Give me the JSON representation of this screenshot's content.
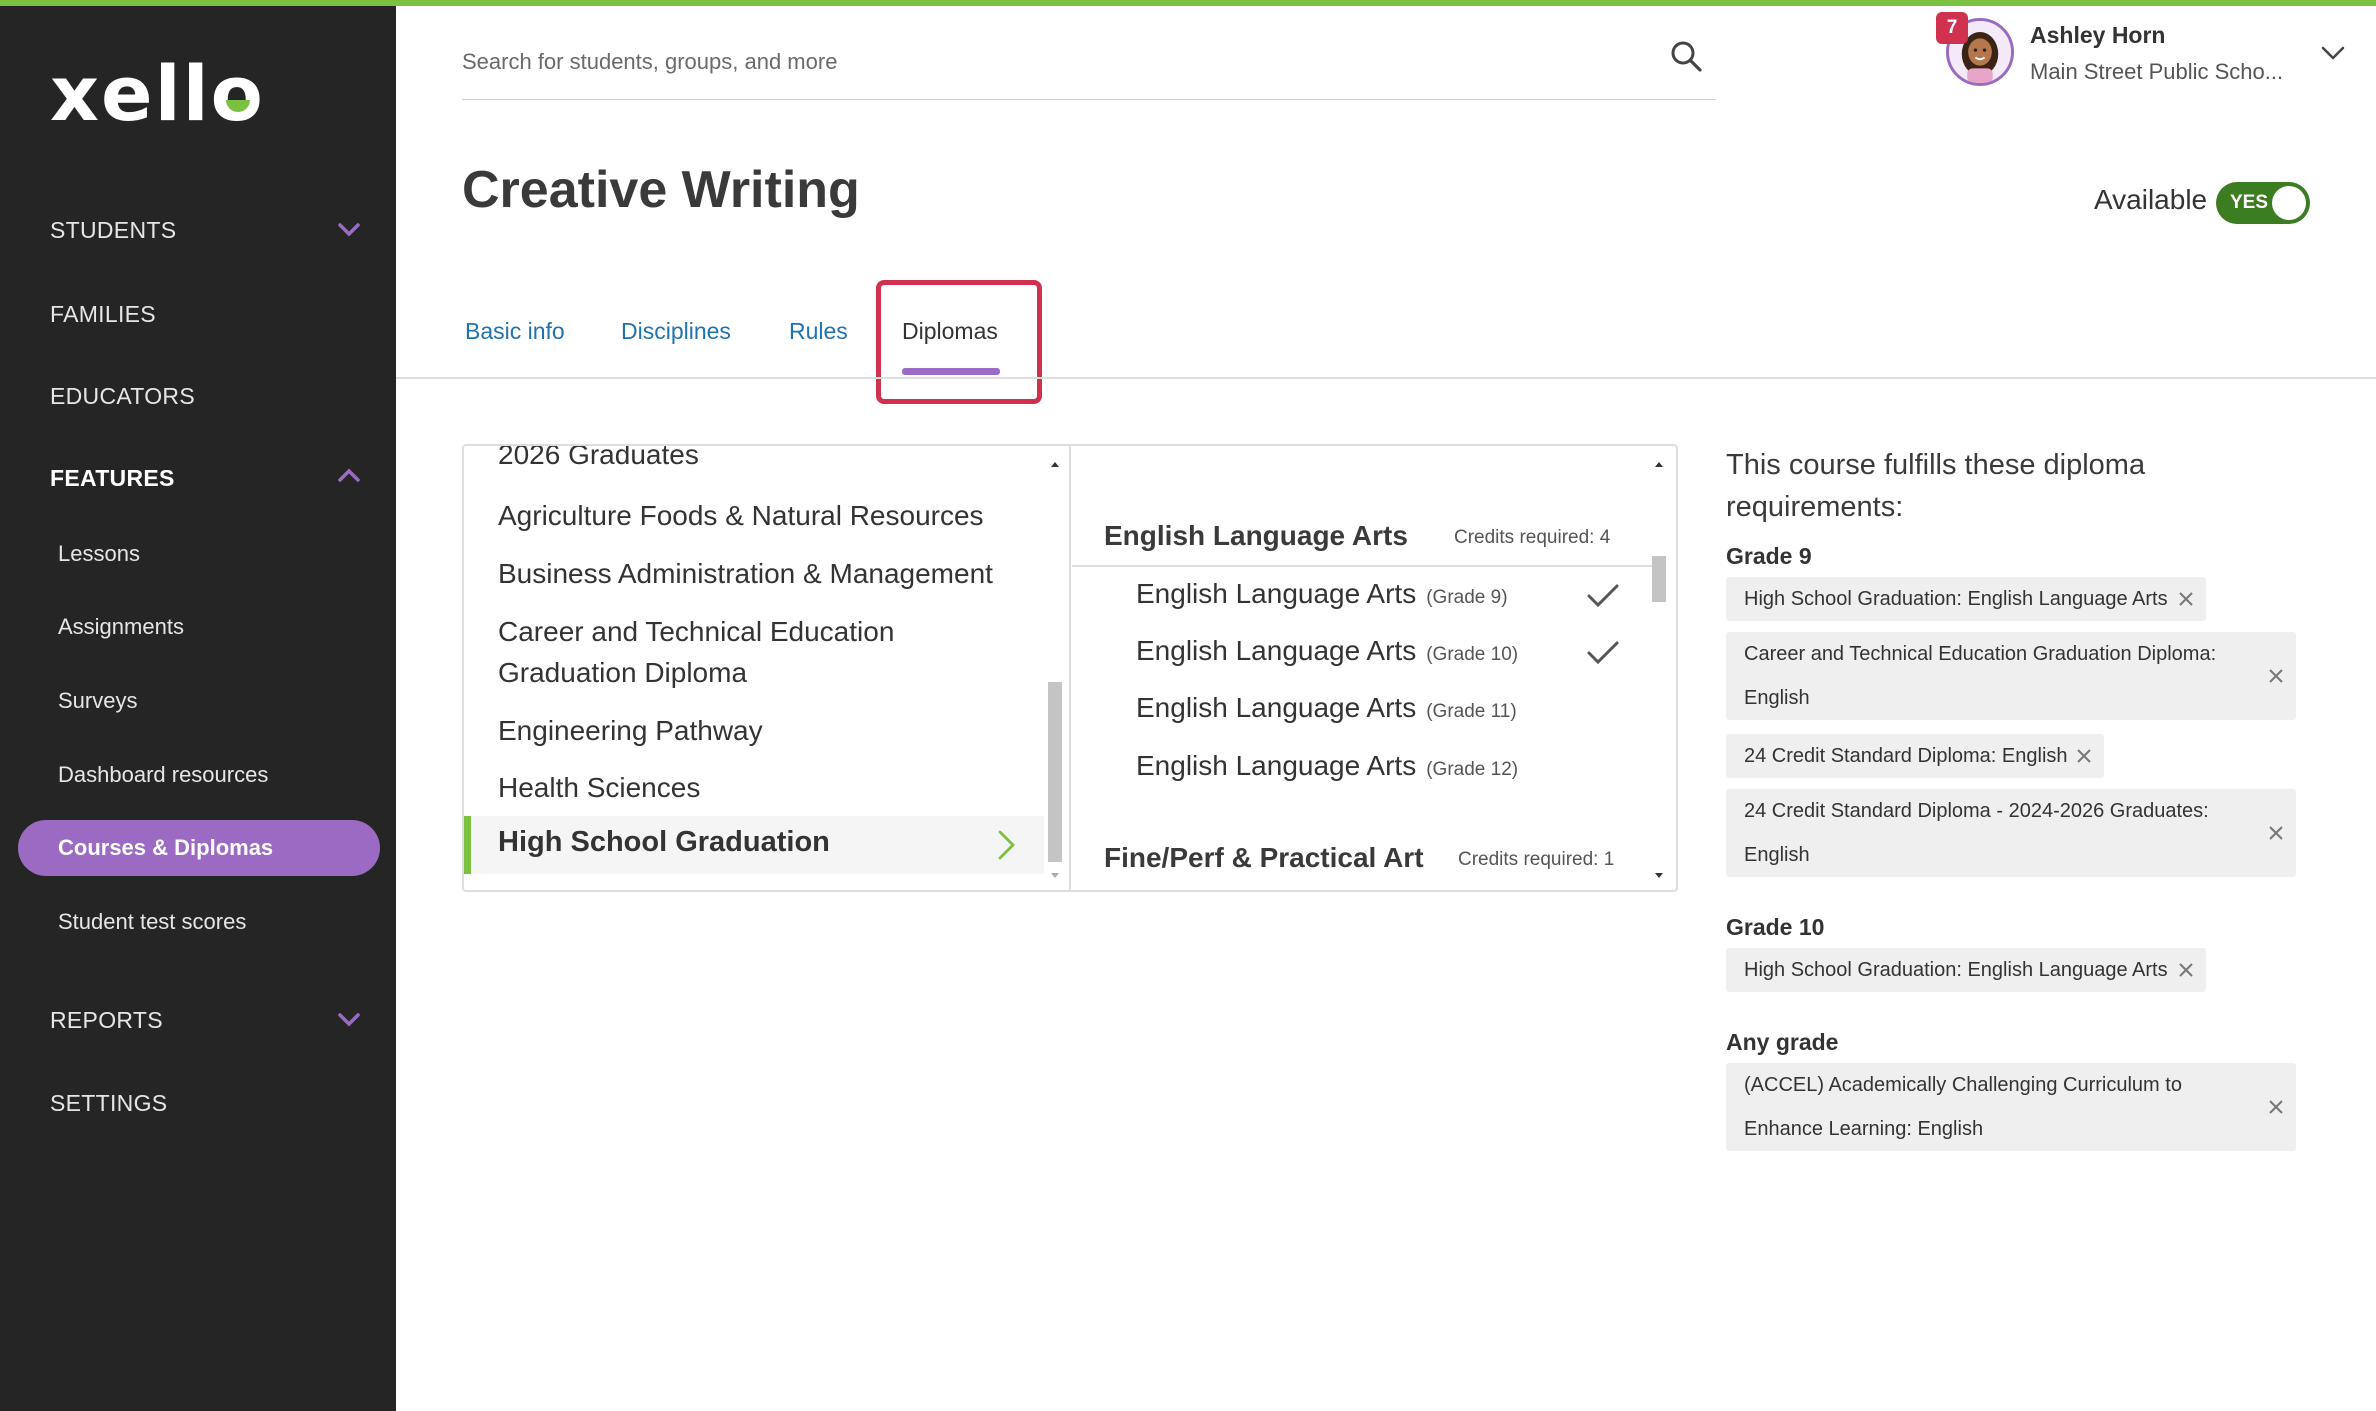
{
  "app": {
    "logo_text": "xello",
    "accent": "#9b6bc3",
    "brand_green": "#7ac142",
    "alert_red": "#d0314e"
  },
  "sidebar": {
    "items": [
      {
        "label": "STUDENTS",
        "chevron": "chevron-down-icon"
      },
      {
        "label": "FAMILIES"
      },
      {
        "label": "EDUCATORS"
      },
      {
        "label": "FEATURES",
        "chevron": "chevron-up-icon"
      },
      {
        "label": "REPORTS",
        "chevron": "chevron-down-icon"
      },
      {
        "label": "SETTINGS"
      }
    ],
    "features_sub": [
      {
        "label": "Lessons"
      },
      {
        "label": "Assignments"
      },
      {
        "label": "Surveys"
      },
      {
        "label": "Dashboard resources"
      },
      {
        "label": "Courses & Diplomas"
      },
      {
        "label": "Student test scores"
      }
    ]
  },
  "header": {
    "search_placeholder": "Search for students, groups, and more",
    "user_name": "Ashley Horn",
    "user_school": "Main Street Public Scho...",
    "notification_count": "7"
  },
  "page": {
    "title": "Creative Writing",
    "available_label": "Available",
    "available_toggle": "YES"
  },
  "tabs": [
    {
      "label": "Basic info"
    },
    {
      "label": "Disciplines"
    },
    {
      "label": "Rules"
    },
    {
      "label": "Diplomas"
    }
  ],
  "diploma_list": {
    "partial_top": "2026 Graduates",
    "items": [
      {
        "label": "Agriculture Foods & Natural Resources"
      },
      {
        "label": "Business Administration & Management"
      },
      {
        "label": "Career and Technical Education Graduation Diploma"
      },
      {
        "label": "Engineering Pathway"
      },
      {
        "label": "Health Sciences"
      }
    ],
    "selected": "High School Graduation"
  },
  "requirement_groups": [
    {
      "title": "English Language Arts",
      "credits": "Credits required: 4",
      "courses": [
        {
          "name": "English Language Arts",
          "grade": "(Grade 9)",
          "checked": true
        },
        {
          "name": "English Language Arts",
          "grade": "(Grade 10)",
          "checked": true
        },
        {
          "name": "English Language Arts",
          "grade": "(Grade 11)",
          "checked": false
        },
        {
          "name": "English Language Arts",
          "grade": "(Grade 12)",
          "checked": false
        }
      ]
    },
    {
      "title": "Fine/Perf & Practical Art",
      "credits": "Credits required: 1"
    }
  ],
  "fulfills": {
    "heading": "This course fulfills these diploma requirements:",
    "grade9_label": "Grade 9",
    "grade9": [
      {
        "text": "High School Graduation: English Language Arts"
      },
      {
        "line1": "Career and Technical Education Graduation Diploma:",
        "line2": "English"
      },
      {
        "text": "24 Credit Standard Diploma: English"
      },
      {
        "line1": "24 Credit Standard Diploma - 2024-2026 Graduates:",
        "line2": "English"
      }
    ],
    "grade10_label": "Grade 10",
    "grade10": [
      {
        "text": "High School Graduation: English Language Arts"
      }
    ],
    "any_label": "Any grade",
    "any": [
      {
        "line1": "(ACCEL) Academically Challenging Curriculum to",
        "line2": "Enhance Learning: English"
      }
    ]
  }
}
